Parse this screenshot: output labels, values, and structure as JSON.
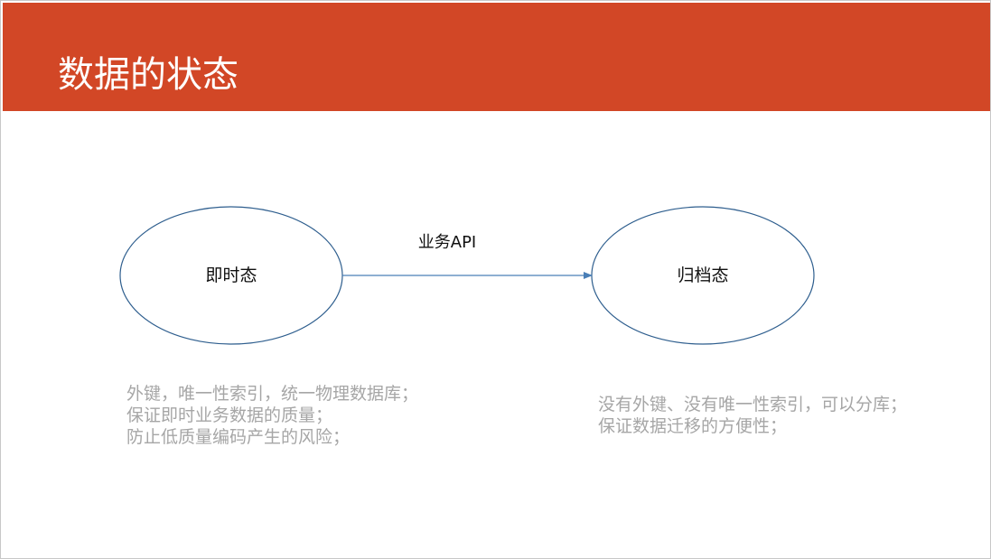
{
  "slide": {
    "title": "数据的状态"
  },
  "colors": {
    "header": "#d24726",
    "title_text": "#ffffff",
    "node_stroke": "#2e5e8e",
    "edge_stroke": "#4a7fb7",
    "note_text": "#a6a6a6"
  },
  "diagram": {
    "nodes": {
      "realtime": {
        "label": "即时态"
      },
      "archived": {
        "label": "归档态"
      }
    },
    "edge": {
      "from": "即时态",
      "to": "归档态",
      "label": "业务API"
    }
  },
  "notes": {
    "realtime": {
      "lines": [
        "外键，唯一性索引，统一物理数据库；",
        "保证即时业务数据的质量；",
        "防止低质量编码产生的风险；"
      ]
    },
    "archived": {
      "lines": [
        "没有外键、没有唯一性索引，可以分库；",
        "保证数据迁移的方便性；"
      ]
    }
  }
}
